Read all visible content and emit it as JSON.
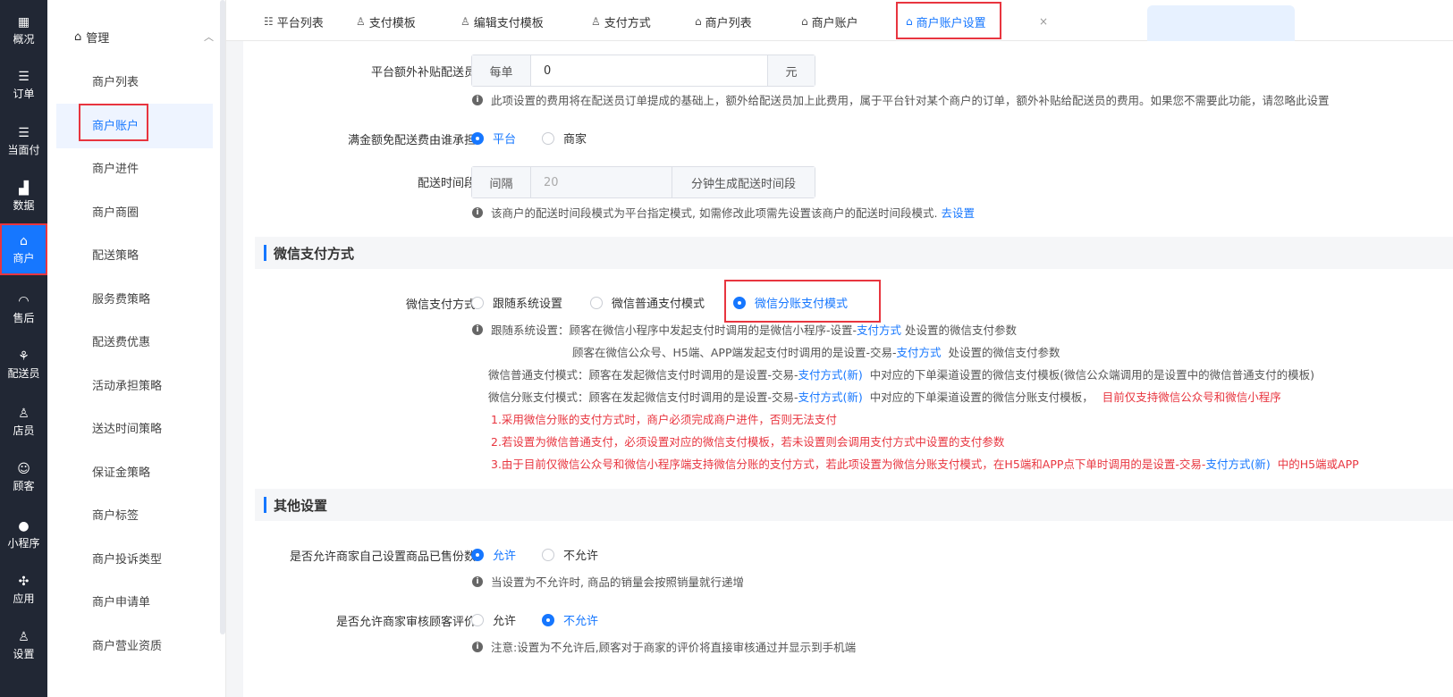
{
  "nav": [
    {
      "icon": "dashboard-icon",
      "glyph": "▦",
      "label": "概况"
    },
    {
      "icon": "list-icon",
      "glyph": "☰",
      "label": "订单"
    },
    {
      "icon": "list-icon",
      "glyph": "☰",
      "label": "当面付"
    },
    {
      "icon": "bar-chart-icon",
      "glyph": "▟",
      "label": "数据"
    },
    {
      "icon": "store-icon",
      "glyph": "⌂",
      "label": "商户"
    },
    {
      "icon": "headset-icon",
      "glyph": "◠",
      "label": "售后"
    },
    {
      "icon": "scooter-icon",
      "glyph": "⚘",
      "label": "配送员"
    },
    {
      "icon": "user-icon",
      "glyph": "♙",
      "label": "店员"
    },
    {
      "icon": "customer-icon",
      "glyph": "☺",
      "label": "顾客"
    },
    {
      "icon": "wechat-icon",
      "glyph": "●",
      "label": "小程序"
    },
    {
      "icon": "apps-icon",
      "glyph": "✣",
      "label": "应用"
    },
    {
      "icon": "settings-icon",
      "glyph": "♙",
      "label": "设置"
    }
  ],
  "sidebar": {
    "group_label": "管理",
    "items": [
      "商户列表",
      "商户账户",
      "商户进件",
      "商户商圈",
      "配送策略",
      "服务费策略",
      "配送费优惠",
      "活动承担策略",
      "送达时间策略",
      "保证金策略",
      "商户标签",
      "商户投诉类型",
      "商户申请单",
      "商户营业资质"
    ]
  },
  "tabs": [
    {
      "label": "平台列表",
      "glyph": "☷"
    },
    {
      "label": "支付模板",
      "glyph": "♙"
    },
    {
      "label": "编辑支付模板",
      "glyph": "♙"
    },
    {
      "label": "支付方式",
      "glyph": "♙"
    },
    {
      "label": "商户列表",
      "glyph": "⌂"
    },
    {
      "label": "商户账户",
      "glyph": "⌂"
    },
    {
      "label": "商户账户设置",
      "glyph": "⌂"
    }
  ],
  "tab_close": "×",
  "form": {
    "subsidy_label": "平台额外补贴配送员",
    "subsidy_prefix": "每单",
    "subsidy_value": "0",
    "subsidy_suffix": "元",
    "subsidy_hint": "此项设置的费用将在配送员订单提成的基础上，额外给配送员加上此费用，属于平台针对某个商户的订单，额外补贴给配送员的费用。如果您不需要此功能，请忽略此设置",
    "free_label": "满金额免配送费由谁承担",
    "free_opt1": "平台",
    "free_opt2": "商家",
    "period_label": "配送时间段",
    "period_prefix": "间隔",
    "period_value": "20",
    "period_suffix": "分钟生成配送时间段",
    "period_hint": "该商户的配送时间段模式为平台指定模式, 如需修改此项需先设置该商户的配送时间段模式.",
    "period_link": "去设置"
  },
  "wechat": {
    "section_title": "微信支付方式",
    "label": "微信支付方式",
    "opt1": "跟随系统设置",
    "opt2": "微信普通支付模式",
    "opt3": "微信分账支付模式",
    "line1_a": "跟随系统设置：顾客在微信小程序中发起支付时调用的是微信小程序-设置-",
    "line1_link": "支付方式",
    "line1_b": "处设置的微信支付参数",
    "line2_a": "顾客在微信公众号、H5端、APP端发起支付时调用的是设置-交易-",
    "line2_link": "支付方式",
    "line2_b": "处设置的微信支付参数",
    "line3_a": "微信普通支付模式：顾客在发起微信支付时调用的是设置-交易-",
    "line3_link": "支付方式(新)",
    "line3_b": "中对应的下单渠道设置的微信支付模板(微信公众端调用的是设置中的微信普通支付的模板)",
    "line4_a": "微信分账支付模式：顾客在发起微信支付时调用的是设置-交易-",
    "line4_link": "支付方式(新)",
    "line4_b": "中对应的下单渠道设置的微信分账支付模板，",
    "line4_red": "目前仅支持微信公众号和微信小程序",
    "note1": "1.采用微信分账的支付方式时，商户必须完成商户进件，否则无法支付",
    "note2": "2.若设置为微信普通支付，必须设置对应的微信支付模板，若未设置则会调用支付方式中设置的支付参数",
    "note3_a": "3.由于目前仅微信公众号和微信小程序端支持微信分账的支付方式，若此项设置为微信分账支付模式，在H5端和APP点下单时调用的是设置-交易-",
    "note3_link": "支付方式(新)",
    "note3_b": "中的H5端或APP"
  },
  "other": {
    "section_title": "其他设置",
    "sold_label": "是否允许商家自己设置商品已售份数",
    "sold_opt1": "允许",
    "sold_opt2": "不允许",
    "sold_hint": "当设置为不允许时, 商品的销量会按照销量就行递增",
    "review_label": "是否允许商家审核顾客评价",
    "review_opt1": "允许",
    "review_opt2": "不允许",
    "review_hint": "注意:设置为不允许后,顾客对于商家的评价将直接审核通过并显示到手机端"
  }
}
